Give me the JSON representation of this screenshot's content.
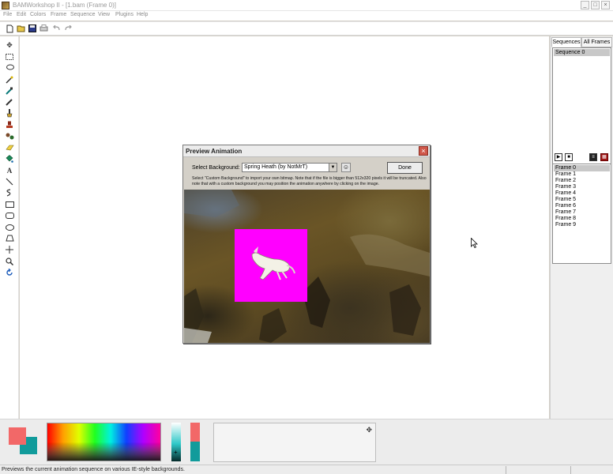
{
  "window": {
    "title": "BAMWorkshop II - [1.bam (Frame 0)]",
    "minimize": "_",
    "maximize": "□",
    "close": "×"
  },
  "menu": [
    "File",
    "Edit",
    "Colors",
    "Frame",
    "Sequence",
    "View",
    "Plugins",
    "Help"
  ],
  "right_panel": {
    "tabs": [
      "Sequences",
      "All Frames"
    ],
    "sequences": [
      "Sequence 0"
    ],
    "frames": [
      "Frame 0",
      "Frame 1",
      "Frame 2",
      "Frame 3",
      "Frame 4",
      "Frame 5",
      "Frame 6",
      "Frame 7",
      "Frame 8",
      "Frame 9"
    ],
    "selected_frame": "Frame 0"
  },
  "dialog": {
    "title": "Preview Animation",
    "close": "×",
    "select_label": "Select Background:",
    "select_value": "Spring Heath (by NotMrT)",
    "done_label": "Done",
    "note": "Select \"Custom Background\" to import your own bitmap. Note that if the file is bigger than 512x320 pixels it will be truncated. Also note that with a custom background you may position the animation anywhere by clicking on the image."
  },
  "colors": {
    "foreground": "#f26868",
    "background": "#119b9b",
    "sprite_bg": "#ff00ff"
  },
  "status": {
    "text": "Previews the current animation sequence on various IE-style backgrounds."
  }
}
